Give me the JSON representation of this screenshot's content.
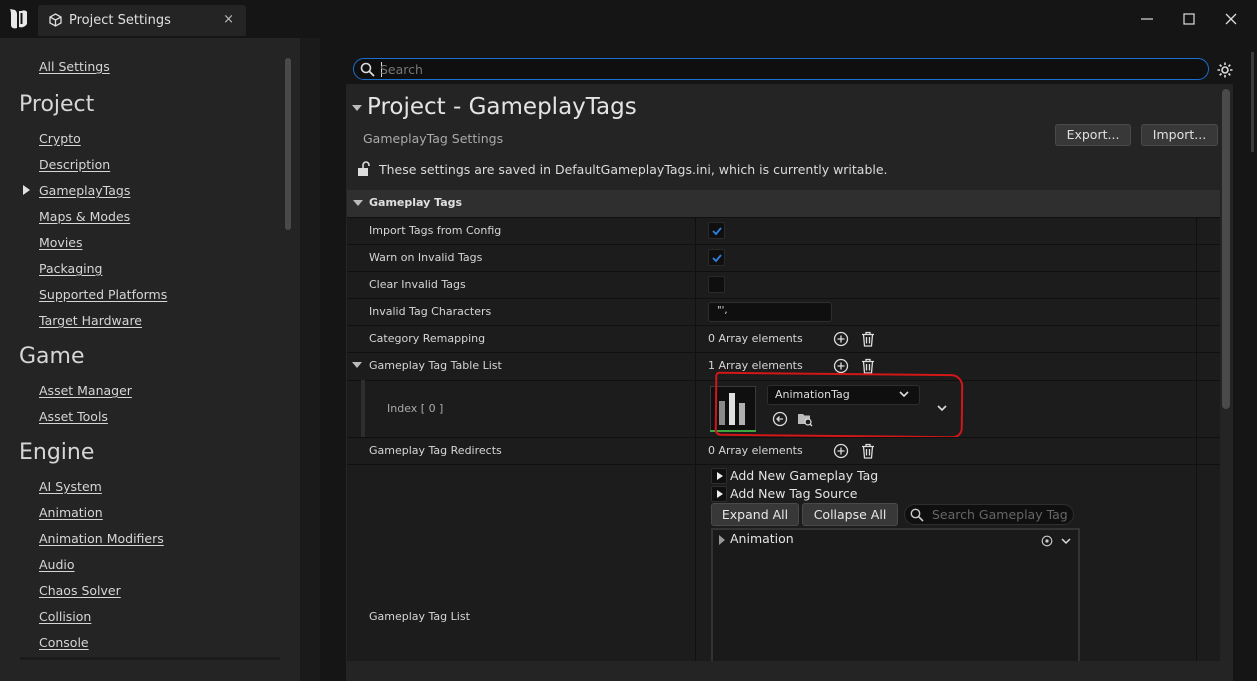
{
  "window": {
    "tab_title": "Project Settings",
    "tab_close": "×"
  },
  "sidebar": {
    "all_settings": "All Settings",
    "categories": [
      {
        "title": "Project",
        "items": [
          "Crypto",
          "Description",
          "GameplayTags",
          "Maps & Modes",
          "Movies",
          "Packaging",
          "Supported Platforms",
          "Target Hardware"
        ]
      },
      {
        "title": "Game",
        "items": [
          "Asset Manager",
          "Asset Tools"
        ]
      },
      {
        "title": "Engine",
        "items": [
          "AI System",
          "Animation",
          "Animation Modifiers",
          "Audio",
          "Chaos Solver",
          "Collision",
          "Console"
        ]
      }
    ],
    "selected_item": "GameplayTags"
  },
  "search": {
    "placeholder": "Search"
  },
  "header": {
    "title": "Project - GameplayTags",
    "subtitle": "GameplayTag Settings",
    "export_label": "Export...",
    "import_label": "Import...",
    "writable_note": "These settings are saved in DefaultGameplayTags.ini, which is currently writable."
  },
  "section": {
    "title": "Gameplay Tags",
    "rows": {
      "import_tags": {
        "label": "Import Tags from Config",
        "checked": true
      },
      "warn_invalid": {
        "label": "Warn on Invalid Tags",
        "checked": true
      },
      "clear_invalid": {
        "label": "Clear Invalid Tags",
        "checked": false
      },
      "invalid_chars": {
        "label": "Invalid Tag Characters",
        "value": "\"',"
      },
      "category_remap": {
        "label": "Category Remapping",
        "value": "0 Array elements"
      },
      "table_list": {
        "label": "Gameplay Tag Table List",
        "value": "1 Array elements"
      },
      "index0": {
        "label": "Index [ 0 ]",
        "asset": "AnimationTag"
      },
      "redirects": {
        "label": "Gameplay Tag Redirects",
        "value": "0 Array elements"
      },
      "tag_list": {
        "label": "Gameplay Tag List",
        "add_tag": "Add New Gameplay Tag",
        "add_source": "Add New Tag Source",
        "expand_all": "Expand All",
        "collapse_all": "Collapse All",
        "search_placeholder": "Search Gameplay Tags",
        "tree_items": [
          "Animation"
        ]
      }
    }
  },
  "colors": {
    "accent": "#1a6fd1",
    "highlight": "#d11717",
    "check": "#2f7fe0"
  }
}
